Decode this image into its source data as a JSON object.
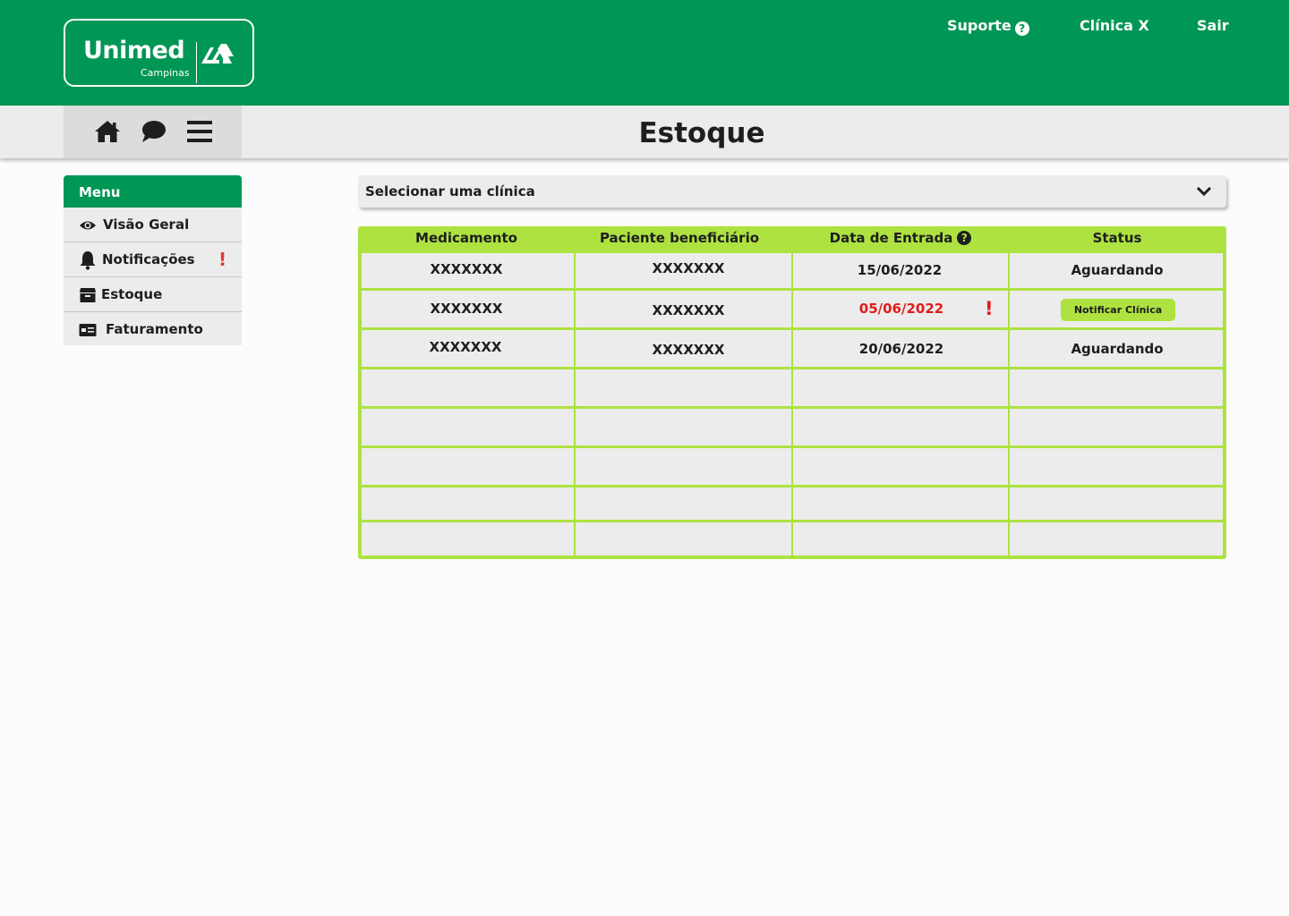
{
  "header": {
    "logo": {
      "word": "Unimed",
      "sub": "Campinas"
    },
    "links": {
      "support": "Suporte",
      "support_icon": "?",
      "clinic": "Clínica X",
      "logout": "Sair"
    }
  },
  "subbar": {
    "icons": [
      "home-icon",
      "chat-icon",
      "hamburger-menu-icon"
    ],
    "title": "Estoque"
  },
  "sidebar": {
    "title": "Menu",
    "items": [
      {
        "label": "Visão Geral",
        "icon": "eye-icon"
      },
      {
        "label": "Notificações",
        "icon": "bell-icon",
        "alert": "!"
      },
      {
        "label": "Estoque",
        "icon": "box-icon"
      },
      {
        "label": "Faturamento",
        "icon": "bill-icon"
      }
    ]
  },
  "clinic_select": {
    "value": "Selecionar uma clínica"
  },
  "table": {
    "headers": [
      "Medicamento",
      "Paciente beneficiário",
      "Data de Entrada",
      "Status"
    ],
    "header_help_icon": "?",
    "rows": [
      {
        "medicamento": "XXXXXXX",
        "paciente": "XXXXXXX",
        "data": "15/06/2022",
        "status": "Aguardando"
      },
      {
        "medicamento": "XXXXXXX",
        "paciente": "XXXXXXX",
        "data": "05/06/2022",
        "data_alert": "!",
        "status_button": "Notificar Clínica"
      },
      {
        "medicamento": "XXXXXXX",
        "paciente": "XXXXXXX",
        "data": "20/06/2022",
        "status": "Aguardando"
      }
    ],
    "empty_rows": 5
  },
  "colors": {
    "brand_green": "#009655",
    "table_green": "#ade240",
    "alert_red": "#e31b1b",
    "sidebar_alert": "#e53935"
  }
}
